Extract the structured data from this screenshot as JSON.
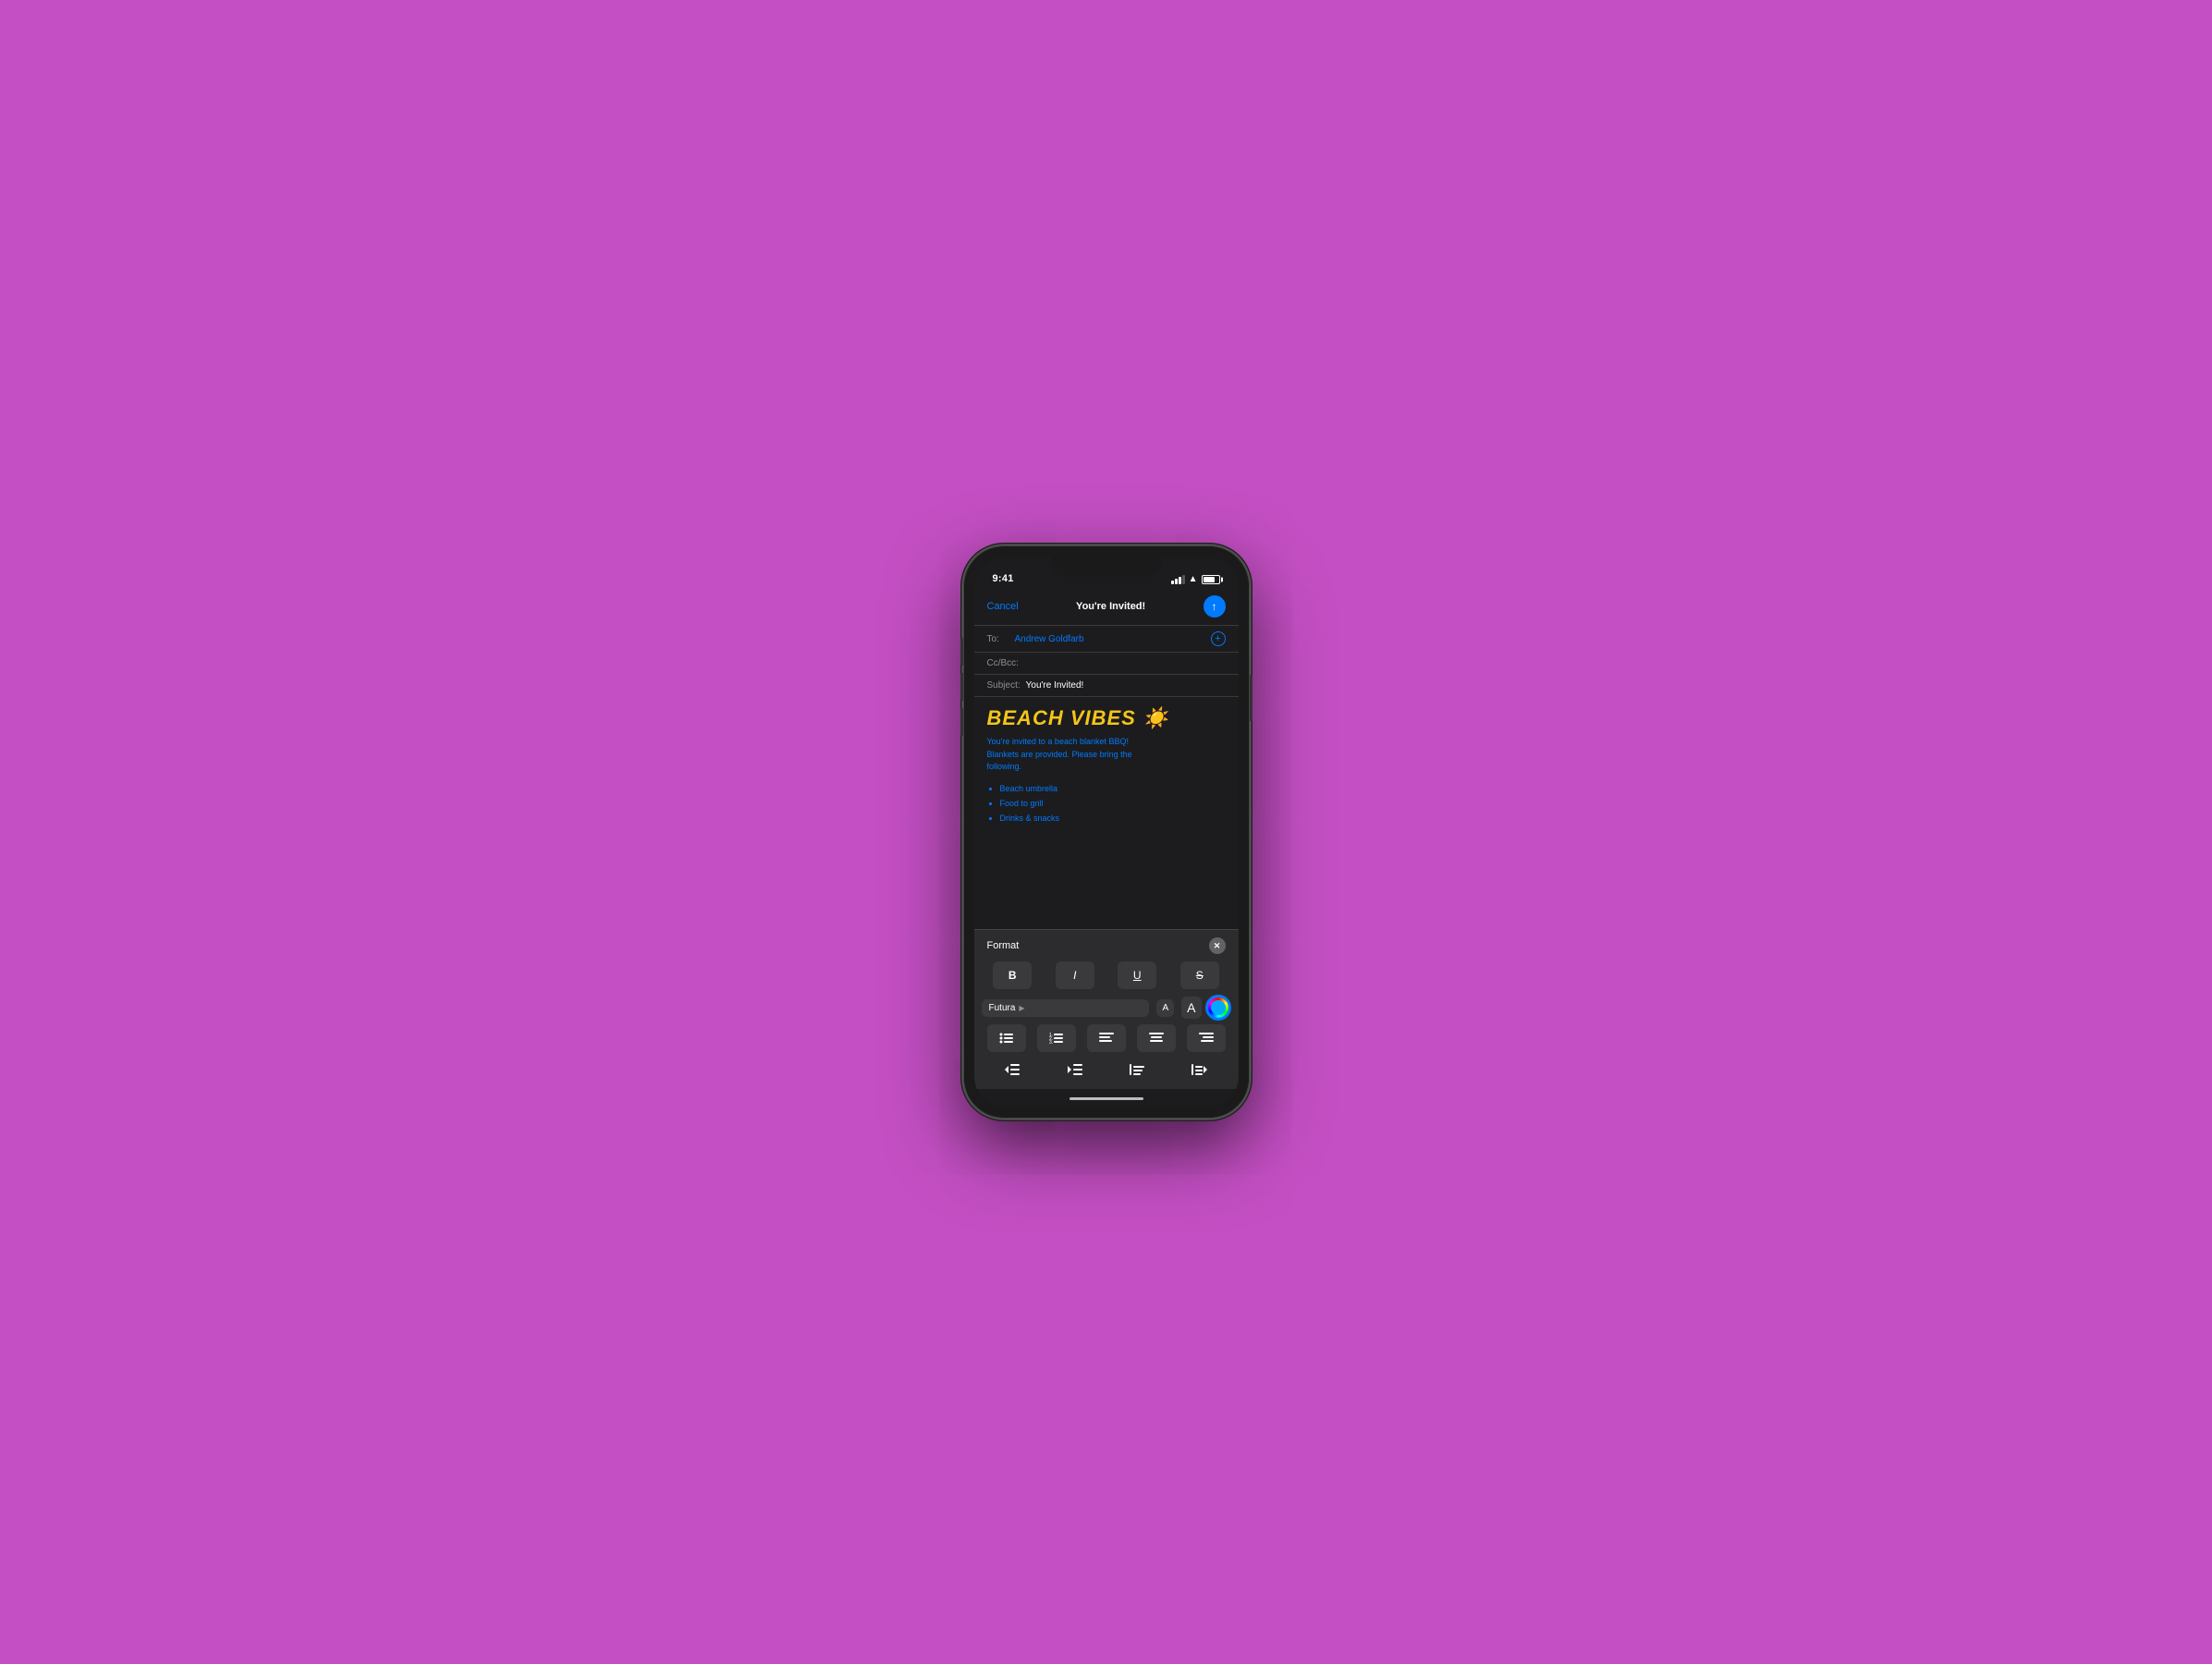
{
  "background": {
    "color": "#c44fc4"
  },
  "phone": {
    "status_bar": {
      "time": "9:41",
      "signal_strength": 3,
      "wifi": true,
      "battery_percent": 80
    },
    "compose": {
      "cancel_label": "Cancel",
      "title": "You're Invited!",
      "to_label": "To:",
      "to_value": "Andrew Goldfarb",
      "cc_label": "Cc/Bcc:",
      "subject_label": "Subject:",
      "subject_value": "You're Invited!",
      "email_heading": "BEACH VIBES ☀️",
      "email_intro": "You're invited to a beach blanket BBQ!\nBlankets are provided. Please bring the\nfollowing.",
      "email_list": [
        "Beach umbrella",
        "Food to grill",
        "Drinks & snacks"
      ]
    },
    "format_panel": {
      "title": "Format",
      "close_label": "×",
      "bold_label": "B",
      "italic_label": "I",
      "underline_label": "U",
      "strikethrough_label": "S",
      "font_name": "Futura",
      "font_size_decrease": "A",
      "font_size_increase": "A",
      "list_unordered_label": "≡",
      "list_ordered_label": "≡",
      "align_left_label": "≡",
      "align_center_label": "≡",
      "align_right_label": "≡",
      "indent_decrease_label": "⇤",
      "indent_increase_label": "⇥",
      "quote_label": "❝",
      "quote_increase_label": "❝→"
    }
  }
}
